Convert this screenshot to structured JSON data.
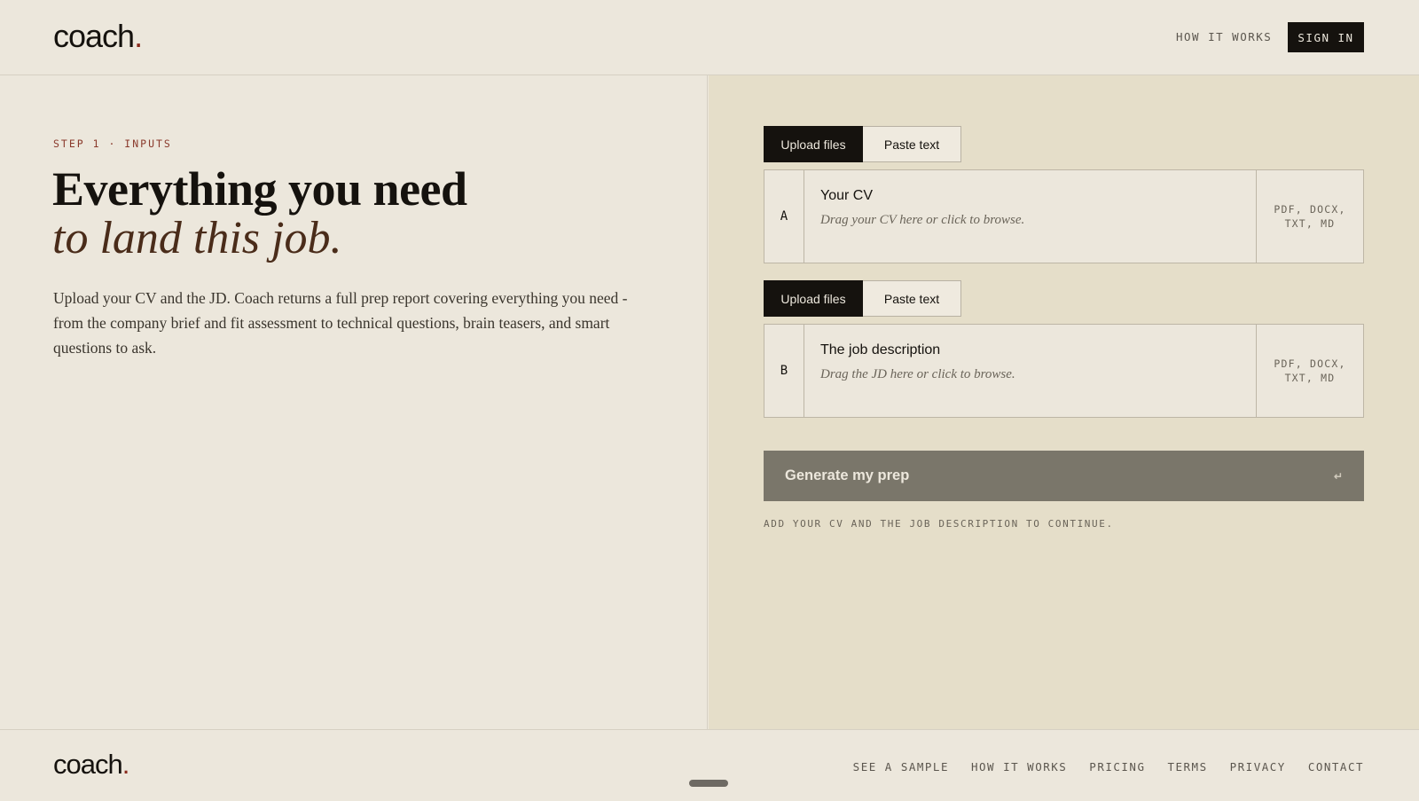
{
  "header": {
    "logo": "coach",
    "logo_dot": ".",
    "nav_how": "HOW IT WORKS",
    "sign_in": "SIGN IN"
  },
  "left": {
    "step": "STEP 1 · INPUTS",
    "headline": "Everything you need",
    "headline_em": "to land this job.",
    "lede": "Upload your CV and the JD. Coach returns a full prep report covering everything you need - from the company brief and fit assessment to technical questions, brain teasers, and smart questions to ask."
  },
  "inputs": [
    {
      "tab_upload": "Upload files",
      "tab_paste": "Paste text",
      "letter": "A",
      "title": "Your CV",
      "hint": "Drag your CV here or click to browse.",
      "formats": "PDF, DOCX, TXT, MD"
    },
    {
      "tab_upload": "Upload files",
      "tab_paste": "Paste text",
      "letter": "B",
      "title": "The job description",
      "hint": "Drag the JD here or click to browse.",
      "formats": "PDF, DOCX, TXT, MD"
    }
  ],
  "generate": {
    "label": "Generate my prep",
    "enter_icon": "↵"
  },
  "continue_hint": "ADD YOUR CV AND THE JOB DESCRIPTION TO CONTINUE.",
  "footer": {
    "logo": "coach",
    "logo_dot": ".",
    "links": [
      "SEE A SAMPLE",
      "HOW IT WORKS",
      "PRICING",
      "TERMS",
      "PRIVACY",
      "CONTACT"
    ]
  },
  "colors": {
    "accent_dot": "#8a2a1c",
    "step": "#8a3a2c",
    "headline_em": "#4a2c1a"
  }
}
